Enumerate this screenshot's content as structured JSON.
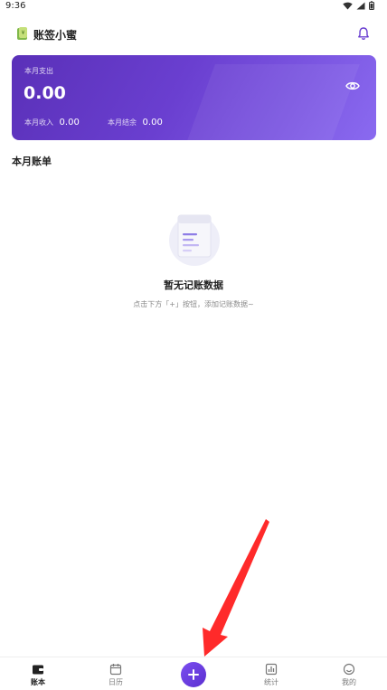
{
  "status_bar": {
    "time": "9:36"
  },
  "header": {
    "app_title": "账签小蜜"
  },
  "summary": {
    "expense_label": "本月支出",
    "expense_amount": "0.00",
    "income_label": "本月收入",
    "income_amount": "0.00",
    "balance_label": "本月结余",
    "balance_amount": "0.00"
  },
  "section": {
    "title": "本月账单"
  },
  "empty_state": {
    "title": "暂无记账数据",
    "hint": "点击下方「+」按钮，添加记账数据~"
  },
  "bottom_nav": {
    "items": [
      {
        "label": "账本",
        "active": true,
        "icon": "wallet-icon"
      },
      {
        "label": "日历",
        "active": false,
        "icon": "calendar-icon"
      },
      {
        "label": "统计",
        "active": false,
        "icon": "chart-icon"
      },
      {
        "label": "我的",
        "active": false,
        "icon": "profile-icon"
      }
    ],
    "add_icon": "plus-icon"
  },
  "colors": {
    "accent": "#6a3fd0",
    "card_start": "#5a30b8",
    "card_end": "#8a6af0",
    "arrow": "#ff2a2a"
  }
}
